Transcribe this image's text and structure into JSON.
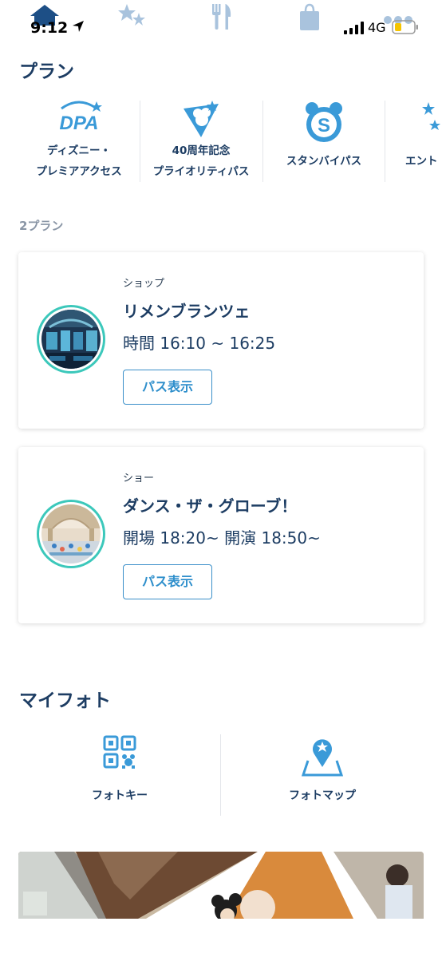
{
  "status_bar": {
    "time": "9:12",
    "network": "4G"
  },
  "top_nav": {
    "icons": [
      "home-icon",
      "stars-icon",
      "dining-icon",
      "shopping-bag-icon",
      "more-icon"
    ]
  },
  "plan_section": {
    "title": "プラン",
    "categories": [
      {
        "icon": "dpa-icon",
        "line1": "ディズニー・",
        "line2": "プレミアアクセス"
      },
      {
        "icon": "anniversary-pennant-icon",
        "line1": "40周年記念",
        "line2": "プライオリティパス"
      },
      {
        "icon": "standby-pass-icon",
        "line1": "スタンバイパス",
        "line2": ""
      },
      {
        "icon": "entry-request-icon",
        "line1": "エント",
        "line2": ""
      }
    ],
    "count_label": "2プラン",
    "plans": [
      {
        "category": "ショップ",
        "title": "リメンブランツェ",
        "time": "時間 16:10 ~ 16:25",
        "button": "パス表示"
      },
      {
        "category": "ショー",
        "title": "ダンス・ザ・グローブ！",
        "time": "開場 18:20~ 開演 18:50~",
        "button": "パス表示"
      }
    ]
  },
  "photo_section": {
    "title": "マイフォト",
    "items": [
      {
        "icon": "qr-photo-key-icon",
        "label": "フォトキー"
      },
      {
        "icon": "photo-map-icon",
        "label": "フォトマップ"
      }
    ]
  },
  "colors": {
    "accent_blue": "#3a9ad8",
    "navy_text": "#1d3d63",
    "teal_ring": "#3cc8bb",
    "muted_gray": "#8a96a6"
  }
}
